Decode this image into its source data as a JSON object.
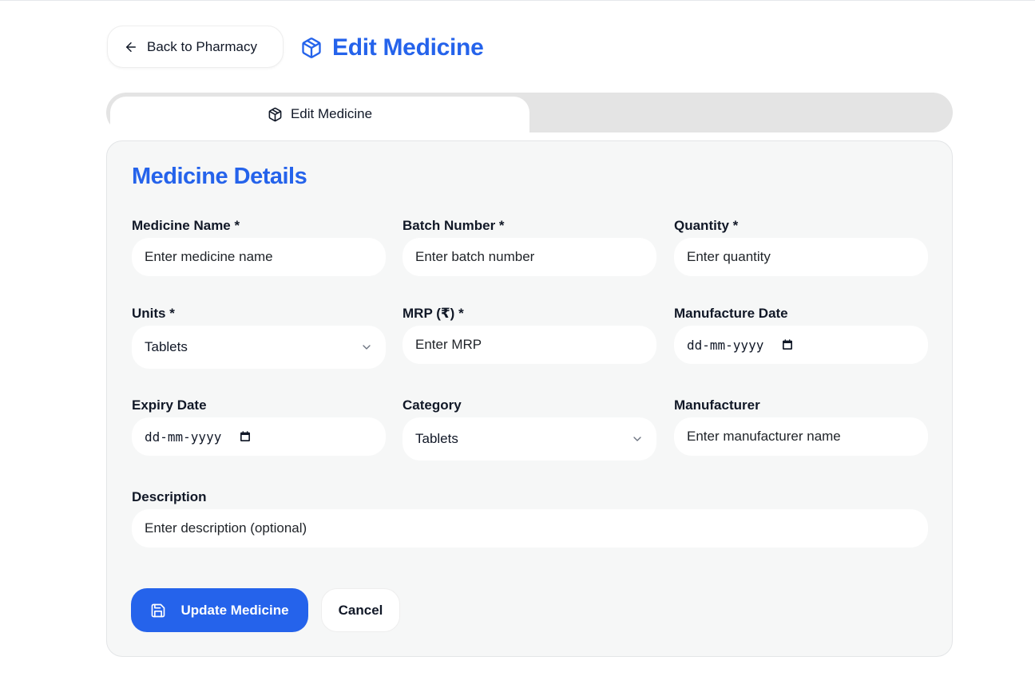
{
  "header": {
    "back_label": "Back to Pharmacy",
    "title": "Edit Medicine"
  },
  "tabs": [
    {
      "label": "Edit Medicine",
      "active": true
    }
  ],
  "form": {
    "section_title": "Medicine Details",
    "fields": {
      "medicine_name": {
        "label": "Medicine Name *",
        "placeholder": "Enter medicine name"
      },
      "batch_number": {
        "label": "Batch Number *",
        "placeholder": "Enter batch number"
      },
      "quantity": {
        "label": "Quantity *",
        "placeholder": "Enter quantity"
      },
      "units": {
        "label": "Units *",
        "value": "Tablets"
      },
      "mrp": {
        "label": "MRP (₹) *",
        "placeholder": "Enter MRP"
      },
      "manufacture_date": {
        "label": "Manufacture Date",
        "placeholder": "dd-mm-yyyy"
      },
      "expiry_date": {
        "label": "Expiry Date",
        "placeholder": "dd-mm-yyyy"
      },
      "category": {
        "label": "Category",
        "value": "Tablets"
      },
      "manufacturer": {
        "label": "Manufacturer",
        "placeholder": "Enter manufacturer name"
      },
      "description": {
        "label": "Description",
        "placeholder": "Enter description (optional)"
      }
    },
    "actions": {
      "submit_label": "Update Medicine",
      "cancel_label": "Cancel"
    }
  },
  "colors": {
    "accent": "#2563eb",
    "card_bg": "#f6f7f7",
    "tab_bar_bg": "#e4e4e4"
  },
  "icons": {
    "back": "arrow-left-icon",
    "title": "package-icon",
    "tab": "package-icon",
    "select": "chevron-down-icon",
    "date": "calendar-icon",
    "save": "save-icon"
  }
}
